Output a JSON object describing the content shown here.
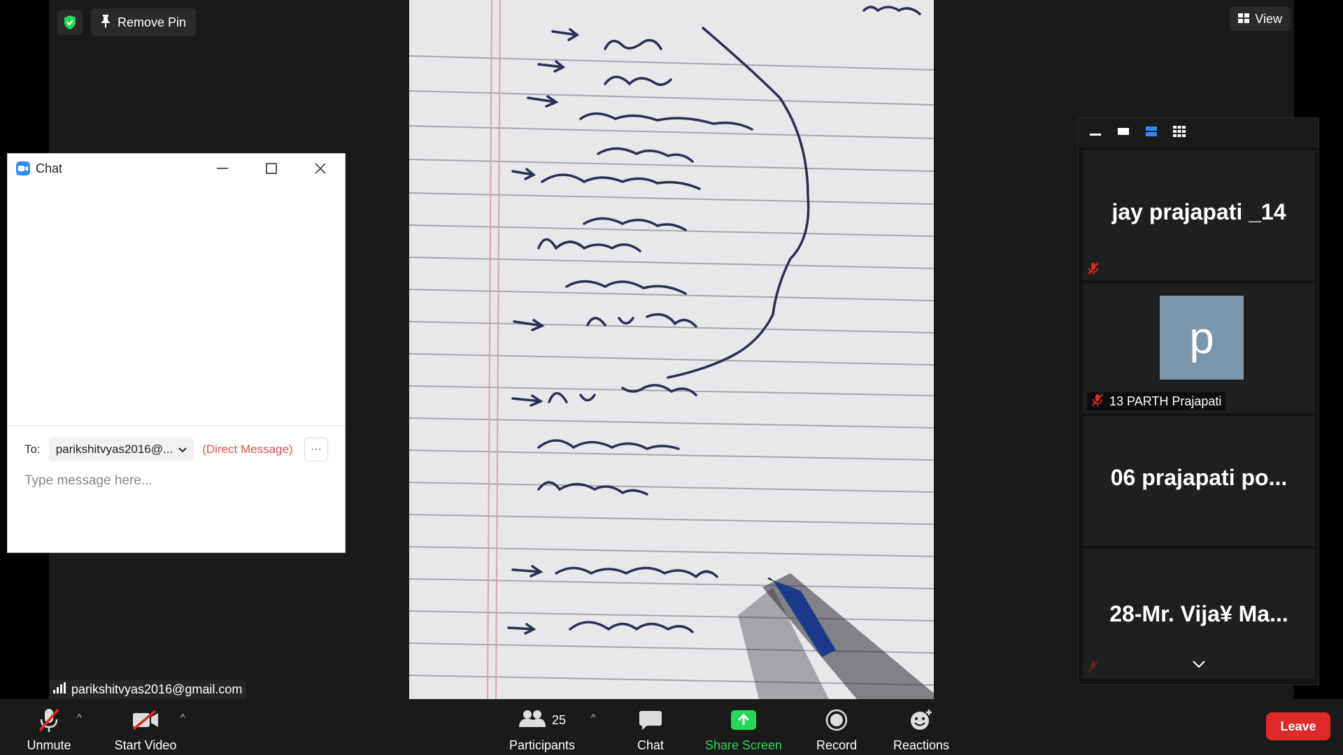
{
  "top": {
    "remove_pin_label": "Remove Pin",
    "view_label": "View"
  },
  "chat": {
    "title": "Chat",
    "to_label": "To:",
    "recipient": "parikshitvyas2016@...",
    "direct_message": "(Direct Message)",
    "more_label": "···",
    "placeholder": "Type message here..."
  },
  "self_name": "parikshitvyas2016@gmail.com",
  "gallery": {
    "tiles": [
      {
        "name": "jay prajapati _14",
        "muted": true
      },
      {
        "name": "13 PARTH Prajapati",
        "avatar_letter": "p",
        "muted": true
      },
      {
        "name": "06 prajapati po...",
        "muted": false
      },
      {
        "name": "28-Mr. Vija¥ Ma...",
        "muted": true
      }
    ]
  },
  "toolbar": {
    "unmute": "Unmute",
    "start_video": "Start Video",
    "participants": "Participants",
    "participants_count": "25",
    "chat": "Chat",
    "share_screen": "Share Screen",
    "record": "Record",
    "reactions": "Reactions",
    "leave": "Leave"
  },
  "colors": {
    "share_green": "#23d959",
    "leave_red": "#e02828",
    "mute_red": "#e02828",
    "zoom_blue": "#2d8cff",
    "dm_red": "#e0554f"
  }
}
